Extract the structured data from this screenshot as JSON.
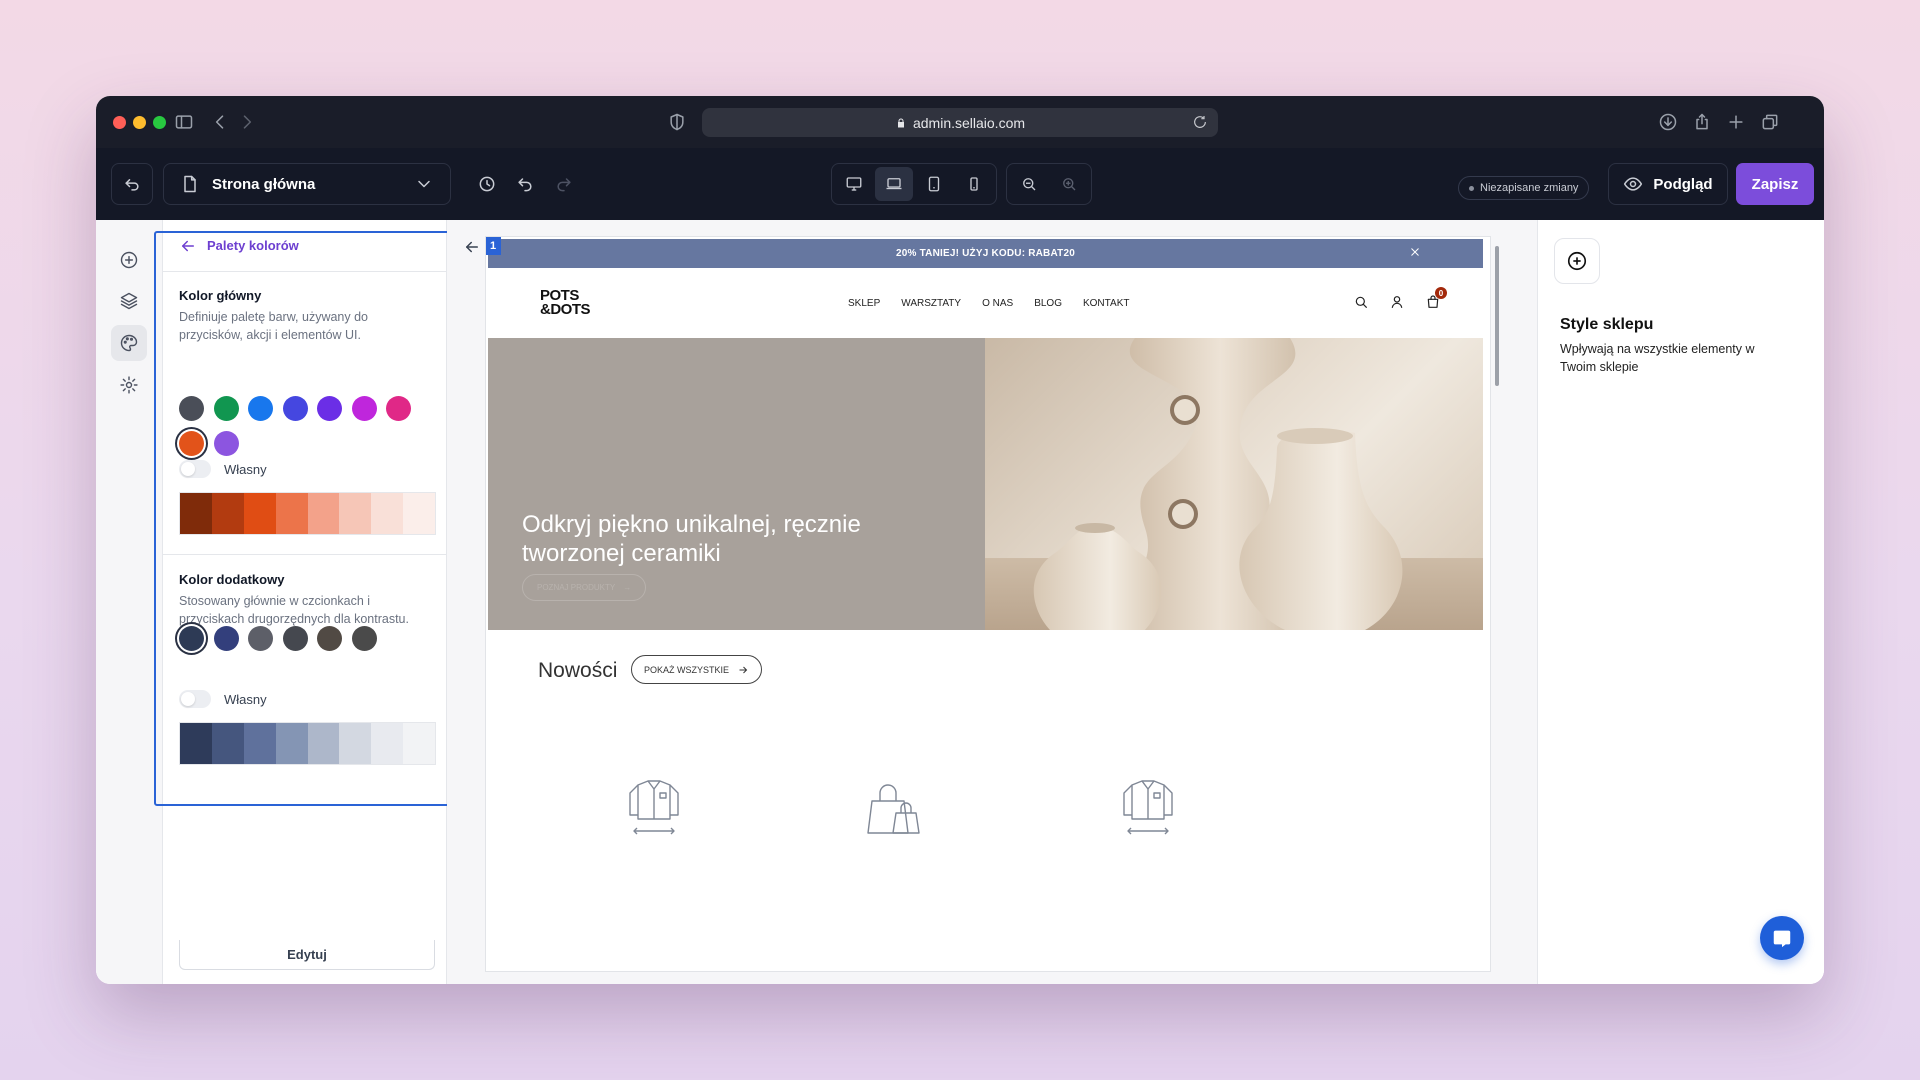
{
  "browser": {
    "url": "admin.sellaio.com",
    "traffic_lights": [
      "#ff5f57",
      "#febc2e",
      "#28c840"
    ]
  },
  "toolbar": {
    "page_name": "Strona główna",
    "unsaved_label": "Niezapisane zmiany",
    "preview_label": "Podgląd",
    "save_label": "Zapisz",
    "accent_color": "#7c4ddb"
  },
  "panel": {
    "title": "Palety kolorów",
    "primary": {
      "title": "Kolor główny",
      "description": "Definiuje paletę barw, używany do przycisków, akcji i elementów UI.",
      "swatches": [
        "#4a4e58",
        "#119650",
        "#1877ed",
        "#4547e0",
        "#6b2ee6",
        "#bf26dc",
        "#e02887",
        "#e2531a",
        "#8c55e0"
      ],
      "selected_index": 7,
      "custom_label": "Własny",
      "ramp": [
        "#7f2b0a",
        "#b23b10",
        "#e04d14",
        "#ec744a",
        "#f3a28a",
        "#f6c6b7",
        "#f9e0d8",
        "#fbeeea"
      ]
    },
    "secondary": {
      "title": "Kolor dodatkowy",
      "description": "Stosowany głównie w czcionkach i przyciskach drugorzędnych dla kontrastu.",
      "swatches": [
        "#2d3a55",
        "#333f7c",
        "#5d5f68",
        "#45484f",
        "#514a44",
        "#4a4a4a"
      ],
      "selected_index": 0,
      "custom_label": "Własny",
      "ramp": [
        "#2e3b5a",
        "#45567e",
        "#5f719c",
        "#8495b4",
        "#adb7ca",
        "#d3d8e1",
        "#e8eaef",
        "#f2f3f5"
      ]
    },
    "edit_label": "Edytuj"
  },
  "preview": {
    "section_number": "1",
    "promo_text": "20% TANIEJ! UŻYJ KODU: RABAT20",
    "logo_line1": "POTS",
    "logo_line2": "&DOTS",
    "menu": [
      "SKLEP",
      "WARSZTATY",
      "O NAS",
      "BLOG",
      "KONTAKT"
    ],
    "cart_count": "0",
    "hero_title": "Odkryj piękno unikalnej, ręcznie tworzonej ceramiki",
    "hero_cta": "POZNAJ PRODUKTY",
    "new_title": "Nowości",
    "new_button": "POKAŻ WSZYSTKIE"
  },
  "right_panel": {
    "title": "Style sklepu",
    "description": "Wpływają na wszystkie elementy w Twoim sklepie"
  }
}
